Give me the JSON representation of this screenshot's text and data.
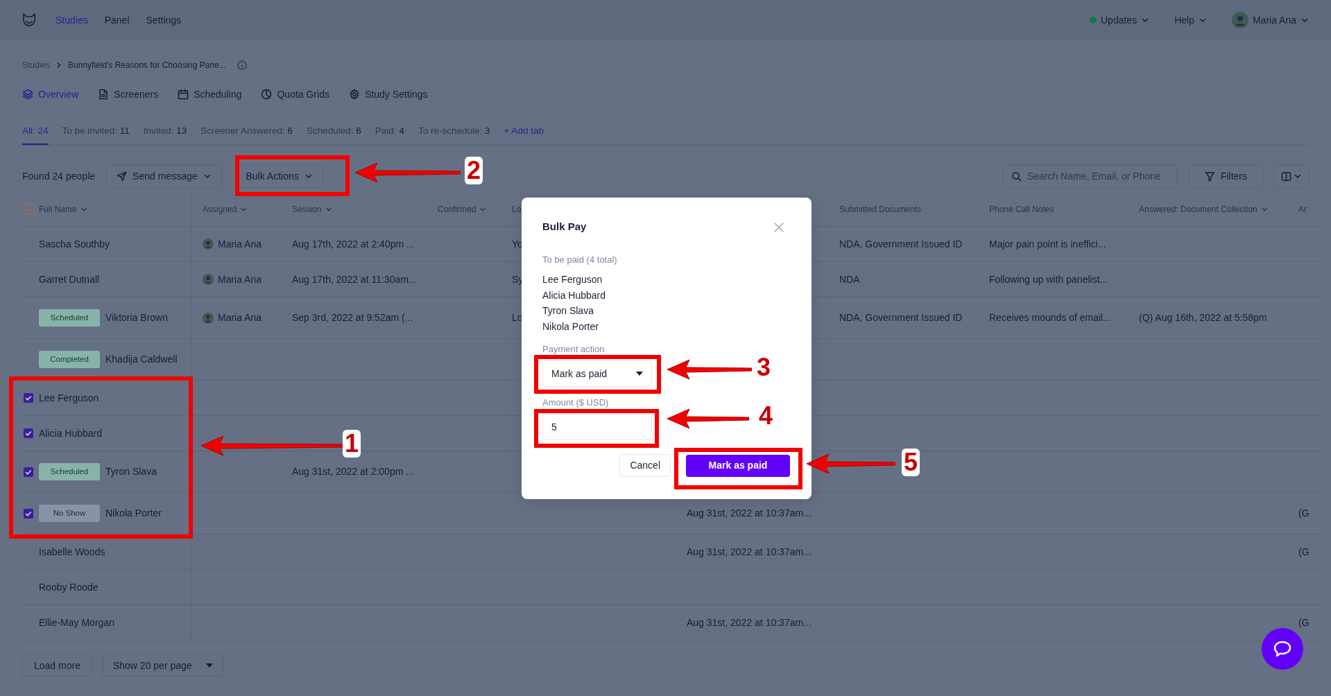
{
  "nav": {
    "links": [
      {
        "label": "Studies",
        "selected": true
      },
      {
        "label": "Panel",
        "selected": false
      },
      {
        "label": "Settings",
        "selected": false
      }
    ],
    "right": [
      {
        "label": "Updates",
        "kind": "status"
      },
      {
        "label": "Help",
        "kind": "menu"
      },
      {
        "label": "Maria Ana",
        "kind": "user"
      }
    ]
  },
  "breadcrumb": [
    "Studies",
    "Bunnyfield's Reasons for Choosing Pane..."
  ],
  "study_tabs": [
    {
      "label": "Overview",
      "kind": "layers",
      "selected": true
    },
    {
      "label": "Screeners",
      "kind": "document",
      "selected": false
    },
    {
      "label": "Scheduling",
      "kind": "calendar",
      "selected": false
    },
    {
      "label": "Quota Grids",
      "kind": "pie",
      "selected": false
    },
    {
      "label": "Study Settings",
      "kind": "gear",
      "selected": false
    }
  ],
  "status_tabs": [
    {
      "label": "All:",
      "count": "24",
      "selected": true
    },
    {
      "label": "To be invited:",
      "count": "11",
      "selected": false
    },
    {
      "label": "Invited:",
      "count": "13",
      "selected": false
    },
    {
      "label": "Screener Answered:",
      "count": "6",
      "selected": false
    },
    {
      "label": "Scheduled:",
      "count": "6",
      "selected": false
    },
    {
      "label": "Paid:",
      "count": "4",
      "selected": false
    },
    {
      "label": "To re-schedule:",
      "count": "3",
      "selected": false
    }
  ],
  "add_tab": "+ Add tab",
  "toolbar": {
    "found": "Found 24 people",
    "send_message": "Send message",
    "bulk_actions": "Bulk Actions",
    "search_placeholder": "Search Name, Email, or Phone",
    "filters": "Filters"
  },
  "table": {
    "select_all_indeterminate": true,
    "columns": [
      {
        "label": "Full Name",
        "kind": "name",
        "sortable": true
      },
      {
        "label": "Assigned",
        "kind": "user",
        "sortable": true
      },
      {
        "label": "Session",
        "kind": "text",
        "sortable": true
      },
      {
        "label": "Confirmed",
        "kind": "text",
        "sortable": true
      },
      {
        "label": "Lo",
        "kind": "text",
        "sortable": false
      },
      {
        "kind": "text"
      },
      {
        "label": "Submitted Documents",
        "kind": "text",
        "sortable": false
      },
      {
        "label": "Phone Call Notes",
        "kind": "text",
        "sortable": false
      },
      {
        "label": "Answered: Document Collection",
        "kind": "text",
        "sortable": true
      },
      {
        "label": "Ar",
        "kind": "text",
        "sortable": false
      }
    ],
    "rows": [
      {
        "checked": false,
        "cells": [
          "Sascha Southby",
          "Maria Ana",
          "Aug 17th, 2022 at 2:40pm ...",
          null,
          "Yo",
          null,
          "NDA, Government Issued ID",
          "Major pain point is ineffici...",
          null,
          null
        ]
      },
      {
        "checked": false,
        "cells": [
          "Garret Dutnall",
          "Maria Ana",
          "Aug 17th, 2022 at 11:30am...",
          null,
          "Sy",
          null,
          "NDA",
          "Following up with panelist...",
          null,
          null
        ]
      },
      {
        "checked": false,
        "status": {
          "label": "Scheduled",
          "kind": "scheduled"
        },
        "cells": [
          "Viktoria Brown",
          "Maria Ana",
          "Sep 3rd, 2022 at 9:52am (...",
          null,
          "Lo",
          null,
          "NDA, Government Issued ID",
          "Receives mounds of email...",
          "(Q) Aug 16th, 2022 at 5:58pm",
          null
        ]
      },
      {
        "checked": false,
        "status": {
          "label": "Completed",
          "kind": "completed"
        },
        "cells": [
          "Khadija Caldwell",
          null,
          null,
          null,
          null,
          null,
          null,
          null,
          null,
          null
        ]
      },
      {
        "checked": true,
        "cells": [
          "Lee Ferguson",
          null,
          null,
          null,
          null,
          null,
          null,
          null,
          null,
          null
        ]
      },
      {
        "checked": true,
        "cells": [
          "Alicia Hubbard",
          null,
          null,
          null,
          null,
          null,
          null,
          null,
          null,
          null
        ]
      },
      {
        "checked": true,
        "status": {
          "label": "Scheduled",
          "kind": "scheduled"
        },
        "cells": [
          "Tyron Slava",
          null,
          "Aug 31st, 2022 at 2:00pm ...",
          null,
          null,
          null,
          null,
          null,
          null,
          null
        ]
      },
      {
        "checked": true,
        "status": {
          "label": "No Show",
          "kind": "no_show"
        },
        "cells": [
          "Nikola Porter",
          null,
          null,
          null,
          null,
          "Aug 31st, 2022 at 10:37am...",
          null,
          null,
          null,
          "(G"
        ]
      },
      {
        "checked": false,
        "cells": [
          "Isabelle Woods",
          null,
          null,
          null,
          null,
          "Aug 31st, 2022 at 10:37am...",
          null,
          null,
          null,
          "(G"
        ]
      },
      {
        "checked": false,
        "cells": [
          "Rooby Roode",
          null,
          null,
          null,
          null,
          null,
          null,
          null,
          null,
          null
        ]
      },
      {
        "checked": false,
        "cells": [
          "Ellie-May Morgan",
          null,
          null,
          null,
          null,
          "Aug 31st, 2022 at 10:37am...",
          null,
          null,
          null,
          "(G"
        ]
      }
    ]
  },
  "footer": {
    "load_more": "Load more",
    "page_size": "Show 20 per page"
  },
  "modal": {
    "title": "Bulk Pay",
    "to_be_paid": "To be paid (4 total)",
    "payees": [
      "Lee Ferguson",
      "Alicia Hubbard",
      "Tyron Slava",
      "Nikola Porter"
    ],
    "payment_action": {
      "label": "Payment action",
      "value": "Mark as paid"
    },
    "amount": {
      "label": "Amount ($ USD)",
      "value": "5"
    },
    "buttons": [
      {
        "label": "Cancel",
        "kind": "secondary"
      },
      {
        "label": "Mark as paid",
        "kind": "primary"
      }
    ]
  },
  "annotations": [
    {
      "label": "1"
    },
    {
      "label": "2"
    },
    {
      "label": "3"
    },
    {
      "label": "4"
    },
    {
      "label": "5"
    }
  ]
}
